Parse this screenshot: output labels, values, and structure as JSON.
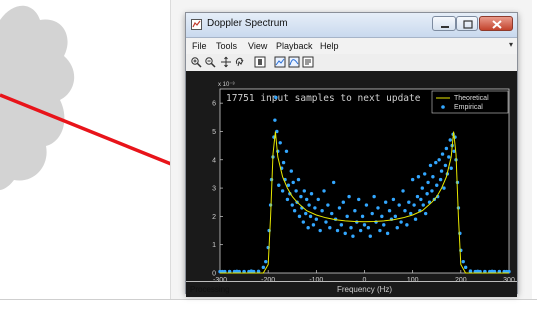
{
  "window": {
    "title": "Doppler Spectrum",
    "buttons": [
      "minimize-icon",
      "maximize-icon",
      "close-icon"
    ]
  },
  "menu": {
    "items": [
      "File",
      "Tools",
      "View",
      "Playback",
      "Help"
    ],
    "pin_icon": "pin-icon"
  },
  "toolbar": {
    "icons": [
      "zoom-in-icon",
      "zoom-out-icon",
      "pan-icon",
      "rotate-icon",
      "data-cursor-icon",
      "scale-icon",
      "measure-icon",
      "properties-icon"
    ]
  },
  "plot": {
    "overlay_text": "17751 input samples to next update",
    "colors": {
      "background": "#000000",
      "theoretical": "#e8e800",
      "empirical": "#33a7ff",
      "axes": "#cfcfcf"
    }
  },
  "chart_data": {
    "type": "scatter",
    "xlabel": "Frequency (Hz)",
    "ylabel": "",
    "y_exponent": "x 10⁻³",
    "xlim": [
      -300,
      300
    ],
    "ylim": [
      0,
      6.5
    ],
    "xticks": [
      -300,
      -200,
      -100,
      0,
      100,
      200,
      300
    ],
    "yticks": [
      0,
      1,
      2,
      3,
      4,
      5,
      6
    ],
    "legend": {
      "placement": "top-right",
      "entries": [
        "Theoretical",
        "Empirical"
      ]
    },
    "series": [
      {
        "name": "Theoretical",
        "kind": "line",
        "x": [
          -300,
          -250,
          -210,
          -200,
          -195,
          -190,
          -185,
          -180,
          -170,
          -160,
          -150,
          -140,
          -130,
          -120,
          -100,
          -80,
          -60,
          -40,
          -20,
          0,
          20,
          40,
          60,
          80,
          100,
          120,
          130,
          140,
          150,
          160,
          170,
          180,
          185,
          190,
          195,
          200,
          210,
          250,
          300
        ],
        "y": [
          0,
          0,
          0,
          0.3,
          2.0,
          4.2,
          5.0,
          4.1,
          3.4,
          3.0,
          2.7,
          2.5,
          2.35,
          2.2,
          2.05,
          1.95,
          1.88,
          1.84,
          1.82,
          1.81,
          1.82,
          1.84,
          1.88,
          1.95,
          2.05,
          2.2,
          2.35,
          2.5,
          2.7,
          3.0,
          3.4,
          4.1,
          5.0,
          4.2,
          2.0,
          0.3,
          0,
          0,
          0
        ]
      },
      {
        "name": "Empirical",
        "kind": "points",
        "x": [
          -295,
          -280,
          -265,
          -250,
          -235,
          -220,
          -210,
          -205,
          -200,
          -198,
          -195,
          -193,
          -190,
          -188,
          -186,
          -184,
          -182,
          -180,
          -178,
          -175,
          -172,
          -170,
          -168,
          -165,
          -162,
          -160,
          -158,
          -155,
          -152,
          -150,
          -148,
          -145,
          -142,
          -140,
          -137,
          -135,
          -132,
          -130,
          -127,
          -125,
          -122,
          -120,
          -117,
          -115,
          -112,
          -110,
          -106,
          -103,
          -100,
          -96,
          -92,
          -88,
          -84,
          -80,
          -76,
          -72,
          -68,
          -64,
          -60,
          -56,
          -52,
          -48,
          -44,
          -40,
          -36,
          -32,
          -28,
          -24,
          -20,
          -16,
          -12,
          -8,
          -4,
          0,
          4,
          8,
          12,
          16,
          20,
          24,
          28,
          32,
          36,
          40,
          44,
          48,
          52,
          56,
          60,
          64,
          68,
          72,
          76,
          80,
          84,
          88,
          92,
          96,
          100,
          103,
          106,
          110,
          112,
          115,
          117,
          120,
          122,
          125,
          127,
          130,
          132,
          135,
          137,
          140,
          142,
          145,
          148,
          150,
          152,
          155,
          158,
          160,
          162,
          165,
          168,
          170,
          172,
          175,
          178,
          180,
          182,
          184,
          186,
          188,
          190,
          193,
          195,
          198,
          200,
          205,
          210,
          220,
          235,
          250,
          265,
          280,
          295
        ],
        "y": [
          0.05,
          0.05,
          0.06,
          0.05,
          0.07,
          0.06,
          0.2,
          0.4,
          0.9,
          1.5,
          2.4,
          3.3,
          4.1,
          4.8,
          5.4,
          6.2,
          5.0,
          4.3,
          3.1,
          4.6,
          3.7,
          2.9,
          3.9,
          3.3,
          4.3,
          2.6,
          3.1,
          2.8,
          3.6,
          2.4,
          3.2,
          2.2,
          2.9,
          2.5,
          3.3,
          2.0,
          2.7,
          2.3,
          1.8,
          2.9,
          2.1,
          2.6,
          1.6,
          2.4,
          2.0,
          2.8,
          1.7,
          2.3,
          1.9,
          2.6,
          1.5,
          2.2,
          2.9,
          1.8,
          2.4,
          1.6,
          2.1,
          3.2,
          1.9,
          1.5,
          2.3,
          1.7,
          2.5,
          1.4,
          2.0,
          2.7,
          1.6,
          1.3,
          2.2,
          1.8,
          2.6,
          1.5,
          2.0,
          1.7,
          2.4,
          1.6,
          1.3,
          2.1,
          2.7,
          1.8,
          2.3,
          1.5,
          2.0,
          1.7,
          2.5,
          1.4,
          2.2,
          1.9,
          2.6,
          2.0,
          1.6,
          2.4,
          1.8,
          2.9,
          2.2,
          1.7,
          2.5,
          2.1,
          3.3,
          2.4,
          1.9,
          2.7,
          3.4,
          2.2,
          2.6,
          3.0,
          2.4,
          3.5,
          2.1,
          2.8,
          3.2,
          2.5,
          3.8,
          2.9,
          3.4,
          2.6,
          3.9,
          3.1,
          2.7,
          4.0,
          3.3,
          3.6,
          4.2,
          3.0,
          3.8,
          4.4,
          3.5,
          4.1,
          4.7,
          3.7,
          4.5,
          4.9,
          4.3,
          4.8,
          4.0,
          3.2,
          2.3,
          1.4,
          0.8,
          0.4,
          0.2,
          0.07,
          0.06,
          0.05,
          0.06,
          0.05,
          0.05
        ]
      }
    ]
  }
}
